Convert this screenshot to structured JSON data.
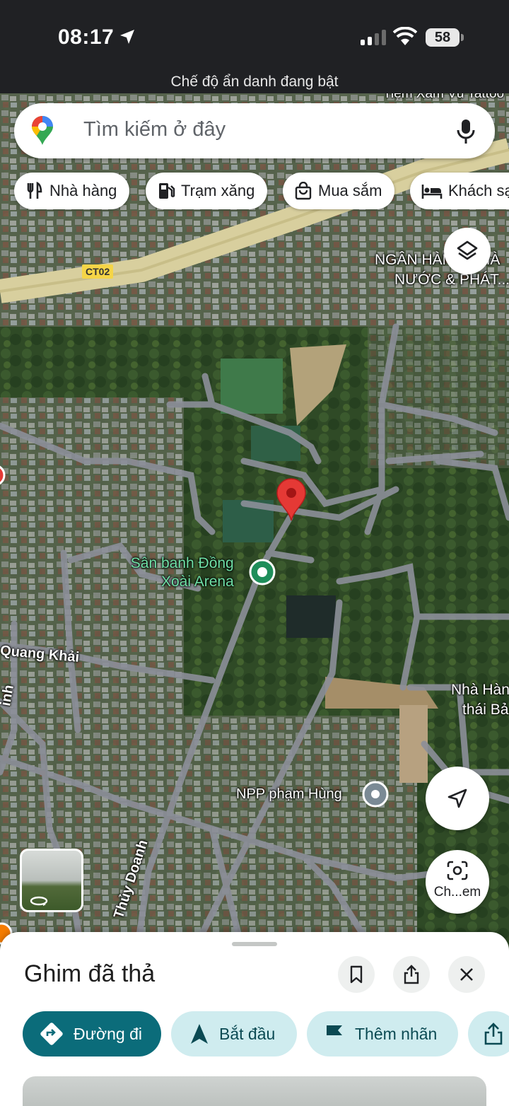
{
  "status_bar": {
    "time": "08:17",
    "battery": "58"
  },
  "banner": {
    "incognito": "Chế độ ẩn danh đang bật"
  },
  "search": {
    "placeholder": "Tìm kiếm ở đây",
    "icon": "google-maps-pin-logo",
    "mic_icon": "mic-icon"
  },
  "chips": [
    {
      "label": "Nhà hàng",
      "icon": "restaurant-icon"
    },
    {
      "label": "Trạm xăng",
      "icon": "gas-station-icon"
    },
    {
      "label": "Mua sắm",
      "icon": "shopping-bag-icon"
    },
    {
      "label": "Khách sạn",
      "icon": "hotel-icon"
    }
  ],
  "map": {
    "road_shield": "CT02",
    "labels": {
      "top_cut": "Tiệm Xăm Vũ Tattoo",
      "bank": "NGÂN HÀNG NHÀ NƯỚC & PHÁT...",
      "bank_line1": "NGÂN HÀNG NHÀ",
      "bank_line2": "NƯỚC & PHÁT...",
      "arena_line1": "Sân banh Đồng",
      "arena_line2": "Xoài Arena",
      "street_quang_khai": "Quang Khải",
      "street_thuy_doanh": "Thủy Doanh",
      "street_left_cut": "inh",
      "restaurant_line1": "Nhà Hàn",
      "restaurant_line2": "thái Bả",
      "npp": "NPP phạm Hùng"
    }
  },
  "controls": {
    "lens_label": "Ch...em"
  },
  "sheet": {
    "title": "Ghim đã thả",
    "actions": [
      {
        "label": "Đường đi",
        "icon": "directions-icon"
      },
      {
        "label": "Bắt đầu",
        "icon": "navigation-arrow-icon"
      },
      {
        "label": "Thêm nhãn",
        "icon": "flag-icon"
      }
    ]
  },
  "colors": {
    "primary": "#0b6c7a",
    "secondary": "#cfecef",
    "pin": "#e53935",
    "poi_green": "#1e8e5a"
  }
}
